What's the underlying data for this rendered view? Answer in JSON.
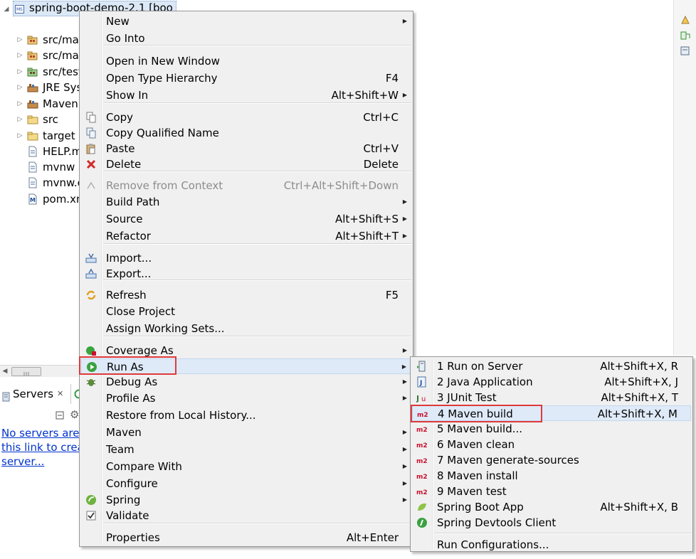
{
  "tree": {
    "items": [
      {
        "label": "spring-boot-demo-2.1 [boo",
        "icon": "project-icon",
        "expanded": true
      },
      {
        "label": "src/mai",
        "icon": "source-folder-icon"
      },
      {
        "label": "src/mai",
        "icon": "source-folder-icon"
      },
      {
        "label": "src/test",
        "icon": "test-source-folder-icon"
      },
      {
        "label": "JRE Sys",
        "icon": "library-icon"
      },
      {
        "label": "Maven",
        "icon": "library-icon"
      },
      {
        "label": "src",
        "icon": "folder-icon"
      },
      {
        "label": "target",
        "icon": "folder-icon"
      },
      {
        "label": "HELP.m",
        "icon": "file-icon"
      },
      {
        "label": "mvnw",
        "icon": "file-icon"
      },
      {
        "label": "mvnw.c",
        "icon": "file-icon"
      },
      {
        "label": "pom.xn",
        "icon": "maven-pom-icon"
      }
    ]
  },
  "servers": {
    "tab_label": "Servers",
    "link_lines": [
      "No servers are",
      "this link to crea",
      "server..."
    ]
  },
  "context_menu": {
    "items": [
      {
        "label": "New",
        "submenu": true
      },
      {
        "label": "Go Into"
      },
      {
        "label": "Open in New Window"
      },
      {
        "label": "Open Type Hierarchy",
        "shortcut": "F4"
      },
      {
        "label": "Show In",
        "shortcut": "Alt+Shift+W",
        "submenu": true
      },
      {
        "label": "Copy",
        "shortcut": "Ctrl+C",
        "icon": "copy-icon"
      },
      {
        "label": "Copy Qualified Name",
        "icon": "copy-qualified-icon"
      },
      {
        "label": "Paste",
        "shortcut": "Ctrl+V",
        "icon": "paste-icon"
      },
      {
        "label": "Delete",
        "shortcut": "Delete",
        "icon": "delete-icon"
      },
      {
        "label": "Remove from Context",
        "shortcut": "Ctrl+Alt+Shift+Down",
        "disabled": true,
        "icon": "remove-context-icon"
      },
      {
        "label": "Build Path",
        "submenu": true
      },
      {
        "label": "Source",
        "shortcut": "Alt+Shift+S",
        "submenu": true
      },
      {
        "label": "Refactor",
        "shortcut": "Alt+Shift+T",
        "submenu": true
      },
      {
        "label": "Import...",
        "icon": "import-icon"
      },
      {
        "label": "Export...",
        "icon": "export-icon"
      },
      {
        "label": "Refresh",
        "shortcut": "F5",
        "icon": "refresh-icon"
      },
      {
        "label": "Close Project"
      },
      {
        "label": "Assign Working Sets..."
      },
      {
        "label": "Coverage As",
        "submenu": true,
        "icon": "coverage-icon"
      },
      {
        "label": "Run As",
        "submenu": true,
        "icon": "run-icon",
        "highlighted": true
      },
      {
        "label": "Debug As",
        "submenu": true,
        "icon": "debug-icon"
      },
      {
        "label": "Profile As",
        "submenu": true
      },
      {
        "label": "Restore from Local History..."
      },
      {
        "label": "Maven",
        "submenu": true
      },
      {
        "label": "Team",
        "submenu": true
      },
      {
        "label": "Compare With",
        "submenu": true
      },
      {
        "label": "Configure",
        "submenu": true
      },
      {
        "label": "Spring",
        "submenu": true,
        "icon": "spring-icon"
      },
      {
        "label": "Validate",
        "icon": "checkbox-icon"
      },
      {
        "label": "Properties",
        "shortcut": "Alt+Enter"
      }
    ]
  },
  "run_as_menu": {
    "items": [
      {
        "label": "1 Run on Server",
        "shortcut": "Alt+Shift+X, R",
        "icon": "server-icon"
      },
      {
        "label": "2 Java Application",
        "shortcut": "Alt+Shift+X, J",
        "icon": "java-app-icon"
      },
      {
        "label": "3 JUnit Test",
        "shortcut": "Alt+Shift+X, T",
        "icon": "junit-icon",
        "icon_text": "Ju"
      },
      {
        "label": "4 Maven build",
        "shortcut": "Alt+Shift+X, M",
        "icon": "m2-icon",
        "icon_text": "m2",
        "highlighted": true
      },
      {
        "label": "5 Maven build...",
        "icon": "m2-icon",
        "icon_text": "m2"
      },
      {
        "label": "6 Maven clean",
        "icon": "m2-icon",
        "icon_text": "m2"
      },
      {
        "label": "7 Maven generate-sources",
        "icon": "m2-icon",
        "icon_text": "m2"
      },
      {
        "label": "8 Maven install",
        "icon": "m2-icon",
        "icon_text": "m2"
      },
      {
        "label": "9 Maven test",
        "icon": "m2-icon",
        "icon_text": "m2"
      },
      {
        "label": "Spring Boot App",
        "shortcut": "Alt+Shift+X, B",
        "icon": "spring-boot-icon"
      },
      {
        "label": "Spring Devtools Client",
        "icon": "devtools-icon"
      },
      {
        "label": "Run Configurations..."
      }
    ]
  },
  "colors": {
    "highlight_box": "#e03a3a",
    "menu_bg": "#f0f0f0",
    "link": "#0033cc"
  }
}
